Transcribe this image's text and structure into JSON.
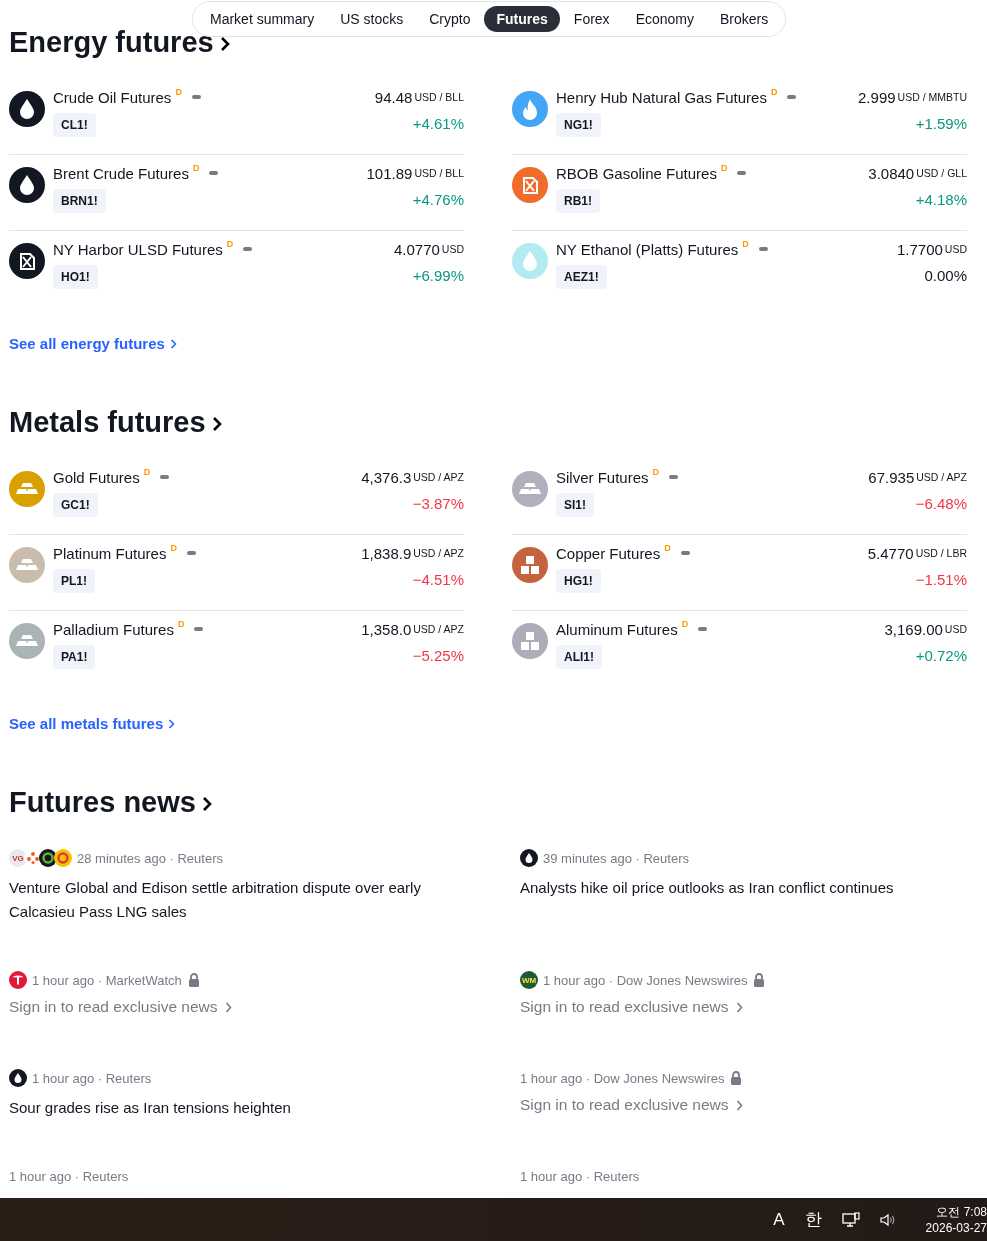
{
  "tabs": [
    {
      "label": "Market summary",
      "selected": false
    },
    {
      "label": "US stocks",
      "selected": false
    },
    {
      "label": "Crypto",
      "selected": false
    },
    {
      "label": "Futures",
      "selected": true
    },
    {
      "label": "Forex",
      "selected": false
    },
    {
      "label": "Economy",
      "selected": false
    },
    {
      "label": "Brokers",
      "selected": false
    }
  ],
  "sections": [
    {
      "title": "Energy futures",
      "see_all": "See all energy futures",
      "items": [
        {
          "name": "Crude Oil Futures",
          "flag": "D",
          "symbol": "CL1!",
          "price": "94.48",
          "unit": "USD / BLL",
          "change": {
            "text": "+4.61%",
            "color": "#089981"
          },
          "kind": "drop",
          "color": "#131722"
        },
        {
          "name": "Henry Hub Natural Gas Futures",
          "flag": "D",
          "symbol": "NG1!",
          "price": "2.999",
          "unit": "USD / MMBTU",
          "change": {
            "text": "+1.59%",
            "color": "#089981"
          },
          "kind": "flame",
          "color": "#42a5f5"
        },
        {
          "name": "Brent Crude Futures",
          "flag": "D",
          "symbol": "BRN1!",
          "price": "101.89",
          "unit": "USD / BLL",
          "change": {
            "text": "+4.76%",
            "color": "#089981"
          },
          "kind": "drop",
          "color": "#131722"
        },
        {
          "name": "RBOB Gasoline Futures",
          "flag": "D",
          "symbol": "RB1!",
          "price": "3.0840",
          "unit": "USD / GLL",
          "change": {
            "text": "+4.18%",
            "color": "#089981"
          },
          "kind": "canister",
          "color": "#ef6c2b"
        },
        {
          "name": "NY Harbor ULSD Futures",
          "flag": "D",
          "symbol": "HO1!",
          "price": "4.0770",
          "unit": "USD",
          "change": {
            "text": "+6.99%",
            "color": "#089981"
          },
          "kind": "canister",
          "color": "#131722"
        },
        {
          "name": "NY Ethanol (Platts) Futures",
          "flag": "D",
          "symbol": "AEZ1!",
          "price": "1.7700",
          "unit": "USD",
          "change": {
            "text": "0.00%",
            "color": "#131722"
          },
          "kind": "drop",
          "color": "#b2ebf2"
        }
      ]
    },
    {
      "title": "Metals futures",
      "see_all": "See all metals futures",
      "items": [
        {
          "name": "Gold Futures",
          "flag": "D",
          "symbol": "GC1!",
          "price": "4,376.3",
          "unit": "USD / APZ",
          "change": {
            "text": "−3.87%",
            "color": "#f23645"
          },
          "kind": "bars",
          "color": "#d9a000"
        },
        {
          "name": "Silver Futures",
          "flag": "D",
          "symbol": "SI1!",
          "price": "67.935",
          "unit": "USD / APZ",
          "change": {
            "text": "−6.48%",
            "color": "#f23645"
          },
          "kind": "bars",
          "color": "#b0afbc"
        },
        {
          "name": "Platinum Futures",
          "flag": "D",
          "symbol": "PL1!",
          "price": "1,838.9",
          "unit": "USD / APZ",
          "change": {
            "text": "−4.51%",
            "color": "#f23645"
          },
          "kind": "bars",
          "color": "#c9bcae"
        },
        {
          "name": "Copper Futures",
          "flag": "D",
          "symbol": "HG1!",
          "price": "5.4770",
          "unit": "USD / LBR",
          "change": {
            "text": "−1.51%",
            "color": "#f23645"
          },
          "kind": "blocks",
          "color": "#c4643e"
        },
        {
          "name": "Palladium Futures",
          "flag": "D",
          "symbol": "PA1!",
          "price": "1,358.0",
          "unit": "USD / APZ",
          "change": {
            "text": "−5.25%",
            "color": "#f23645"
          },
          "kind": "bars",
          "color": "#aab4b4"
        },
        {
          "name": "Aluminum Futures",
          "flag": "D",
          "symbol": "ALI1!",
          "price": "3,169.00",
          "unit": "USD",
          "change": {
            "text": "+0.72%",
            "color": "#089981"
          },
          "kind": "blocks",
          "color": "#adadb9"
        }
      ]
    }
  ],
  "news": {
    "title": "Futures news",
    "items": [
      {
        "logos": [
          {
            "kind": "text",
            "label": "VG",
            "color": "#e8eaf0"
          },
          {
            "kind": "flower",
            "color": "#f0602a"
          },
          {
            "kind": "ring",
            "color": "#131722"
          },
          {
            "kind": "ring",
            "color": "#f5c400"
          }
        ],
        "meta": "28 minutes ago · Reuters",
        "headline": "Venture Global and Edison settle arbitration dispute over early Calcasieu Pass LNG sales"
      },
      {
        "logos": [
          {
            "kind": "drop",
            "color": "#131722"
          }
        ],
        "meta": "39 minutes ago · Reuters",
        "headline": "Analysts hike oil price outlooks as Iran conflict continues"
      },
      {
        "logos": [
          {
            "kind": "tesla",
            "color": "#e31937"
          }
        ],
        "meta": "1 hour ago · MarketWatch",
        "locked": true,
        "sign_in": "Sign in to read exclusive news"
      },
      {
        "logos": [
          {
            "kind": "text",
            "label": "WM",
            "color": "#1e5b34"
          }
        ],
        "meta": "1 hour ago · Dow Jones Newswires",
        "locked": true,
        "sign_in": "Sign in to read exclusive news"
      },
      {
        "logos": [
          {
            "kind": "drop",
            "color": "#131722"
          }
        ],
        "meta": "1 hour ago · Reuters",
        "headline": "Sour grades rise as Iran tensions heighten"
      },
      {
        "meta": "1 hour ago · Dow Jones Newswires",
        "locked": true,
        "sign_in": "Sign in to read exclusive news"
      },
      {
        "meta": "1 hour ago · Reuters"
      },
      {
        "meta": "1 hour ago · Reuters"
      }
    ]
  },
  "taskbar": {
    "input_mode": "A",
    "ime": "한",
    "time": "오전 7:08",
    "date": "2026-03-27"
  }
}
